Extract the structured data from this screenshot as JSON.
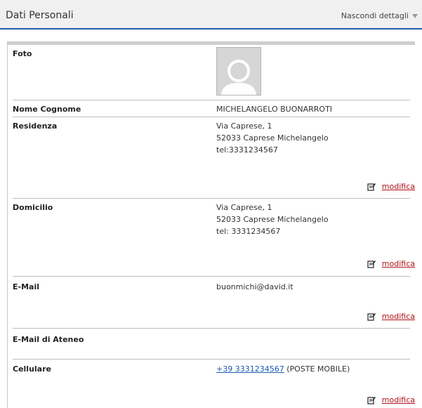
{
  "header": {
    "title": "Dati Personali",
    "toggle_label": "Nascondi dettagli"
  },
  "rows": {
    "foto": {
      "label": "Foto"
    },
    "nome": {
      "label": "Nome Cognome",
      "value": "MICHELANGELO BUONARROTI"
    },
    "residenza": {
      "label": "Residenza",
      "lines": [
        "Via Caprese, 1",
        "52033 Caprese Michelangelo",
        "tel:3331234567"
      ],
      "edit_label": "modifica"
    },
    "domicilio": {
      "label": "Domicilio",
      "lines": [
        "Via Caprese, 1",
        "52033 Caprese Michelangelo",
        "tel: 3331234567"
      ],
      "edit_label": "modifica"
    },
    "email": {
      "label": "E-Mail",
      "value": "buonmichi@david.it",
      "edit_label": "modifica"
    },
    "email_ateneo": {
      "label": "E-Mail di Ateneo",
      "value": ""
    },
    "cellulare": {
      "label": "Cellulare",
      "phone_link": "+39 3331234567",
      "carrier": "(POSTE MOBILE)",
      "edit_label": "modifica"
    }
  },
  "colors": {
    "accent": "#1f5ba8",
    "link": "#1a5bb5",
    "edit_link": "#b0121b"
  },
  "icons": {
    "toggle": "triangle-down-icon",
    "avatar": "user-placeholder-icon",
    "edit": "edit-document-icon"
  }
}
